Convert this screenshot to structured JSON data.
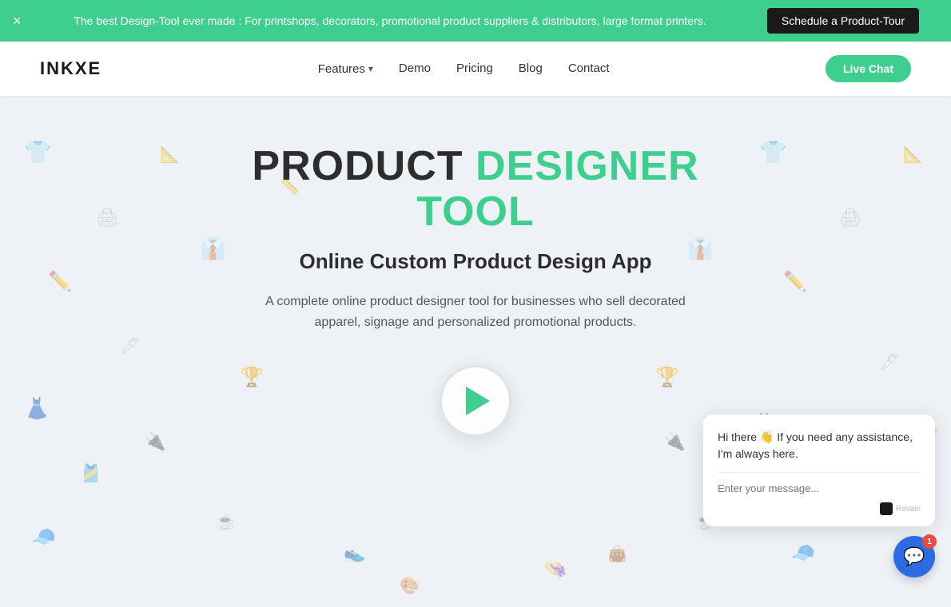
{
  "banner": {
    "text": "The best Design-Tool ever made : For printshops, decorators, promotional product suppliers & distributors, large format printers.",
    "schedule_btn": "Schedule a Product-Tour",
    "close_icon": "×"
  },
  "navbar": {
    "logo": "INKXE",
    "links": [
      {
        "label": "Features",
        "has_dropdown": true
      },
      {
        "label": "Demo",
        "has_dropdown": false
      },
      {
        "label": "Pricing",
        "has_dropdown": false
      },
      {
        "label": "Blog",
        "has_dropdown": false
      },
      {
        "label": "Contact",
        "has_dropdown": false
      }
    ],
    "live_chat_btn": "Live Chat"
  },
  "hero": {
    "title_part1": "PRODUCT ",
    "title_part2": "DESIGNER TOOL",
    "subtitle": "Online Custom Product Design App",
    "description": "A complete online product designer tool for businesses who sell decorated apparel, signage and personalized promotional products.",
    "play_btn_label": "Play Video"
  },
  "chat": {
    "greeting": "Hi there 👋 If you need any assistance, I'm always here.",
    "input_placeholder": "Enter your message...",
    "badge_count": "1",
    "revain_label": "Revain"
  },
  "colors": {
    "accent_green": "#3ecf8e",
    "dark": "#1a1a1a",
    "blue": "#2d6be4",
    "red": "#e74c3c",
    "hero_bg": "#eef2f7"
  }
}
